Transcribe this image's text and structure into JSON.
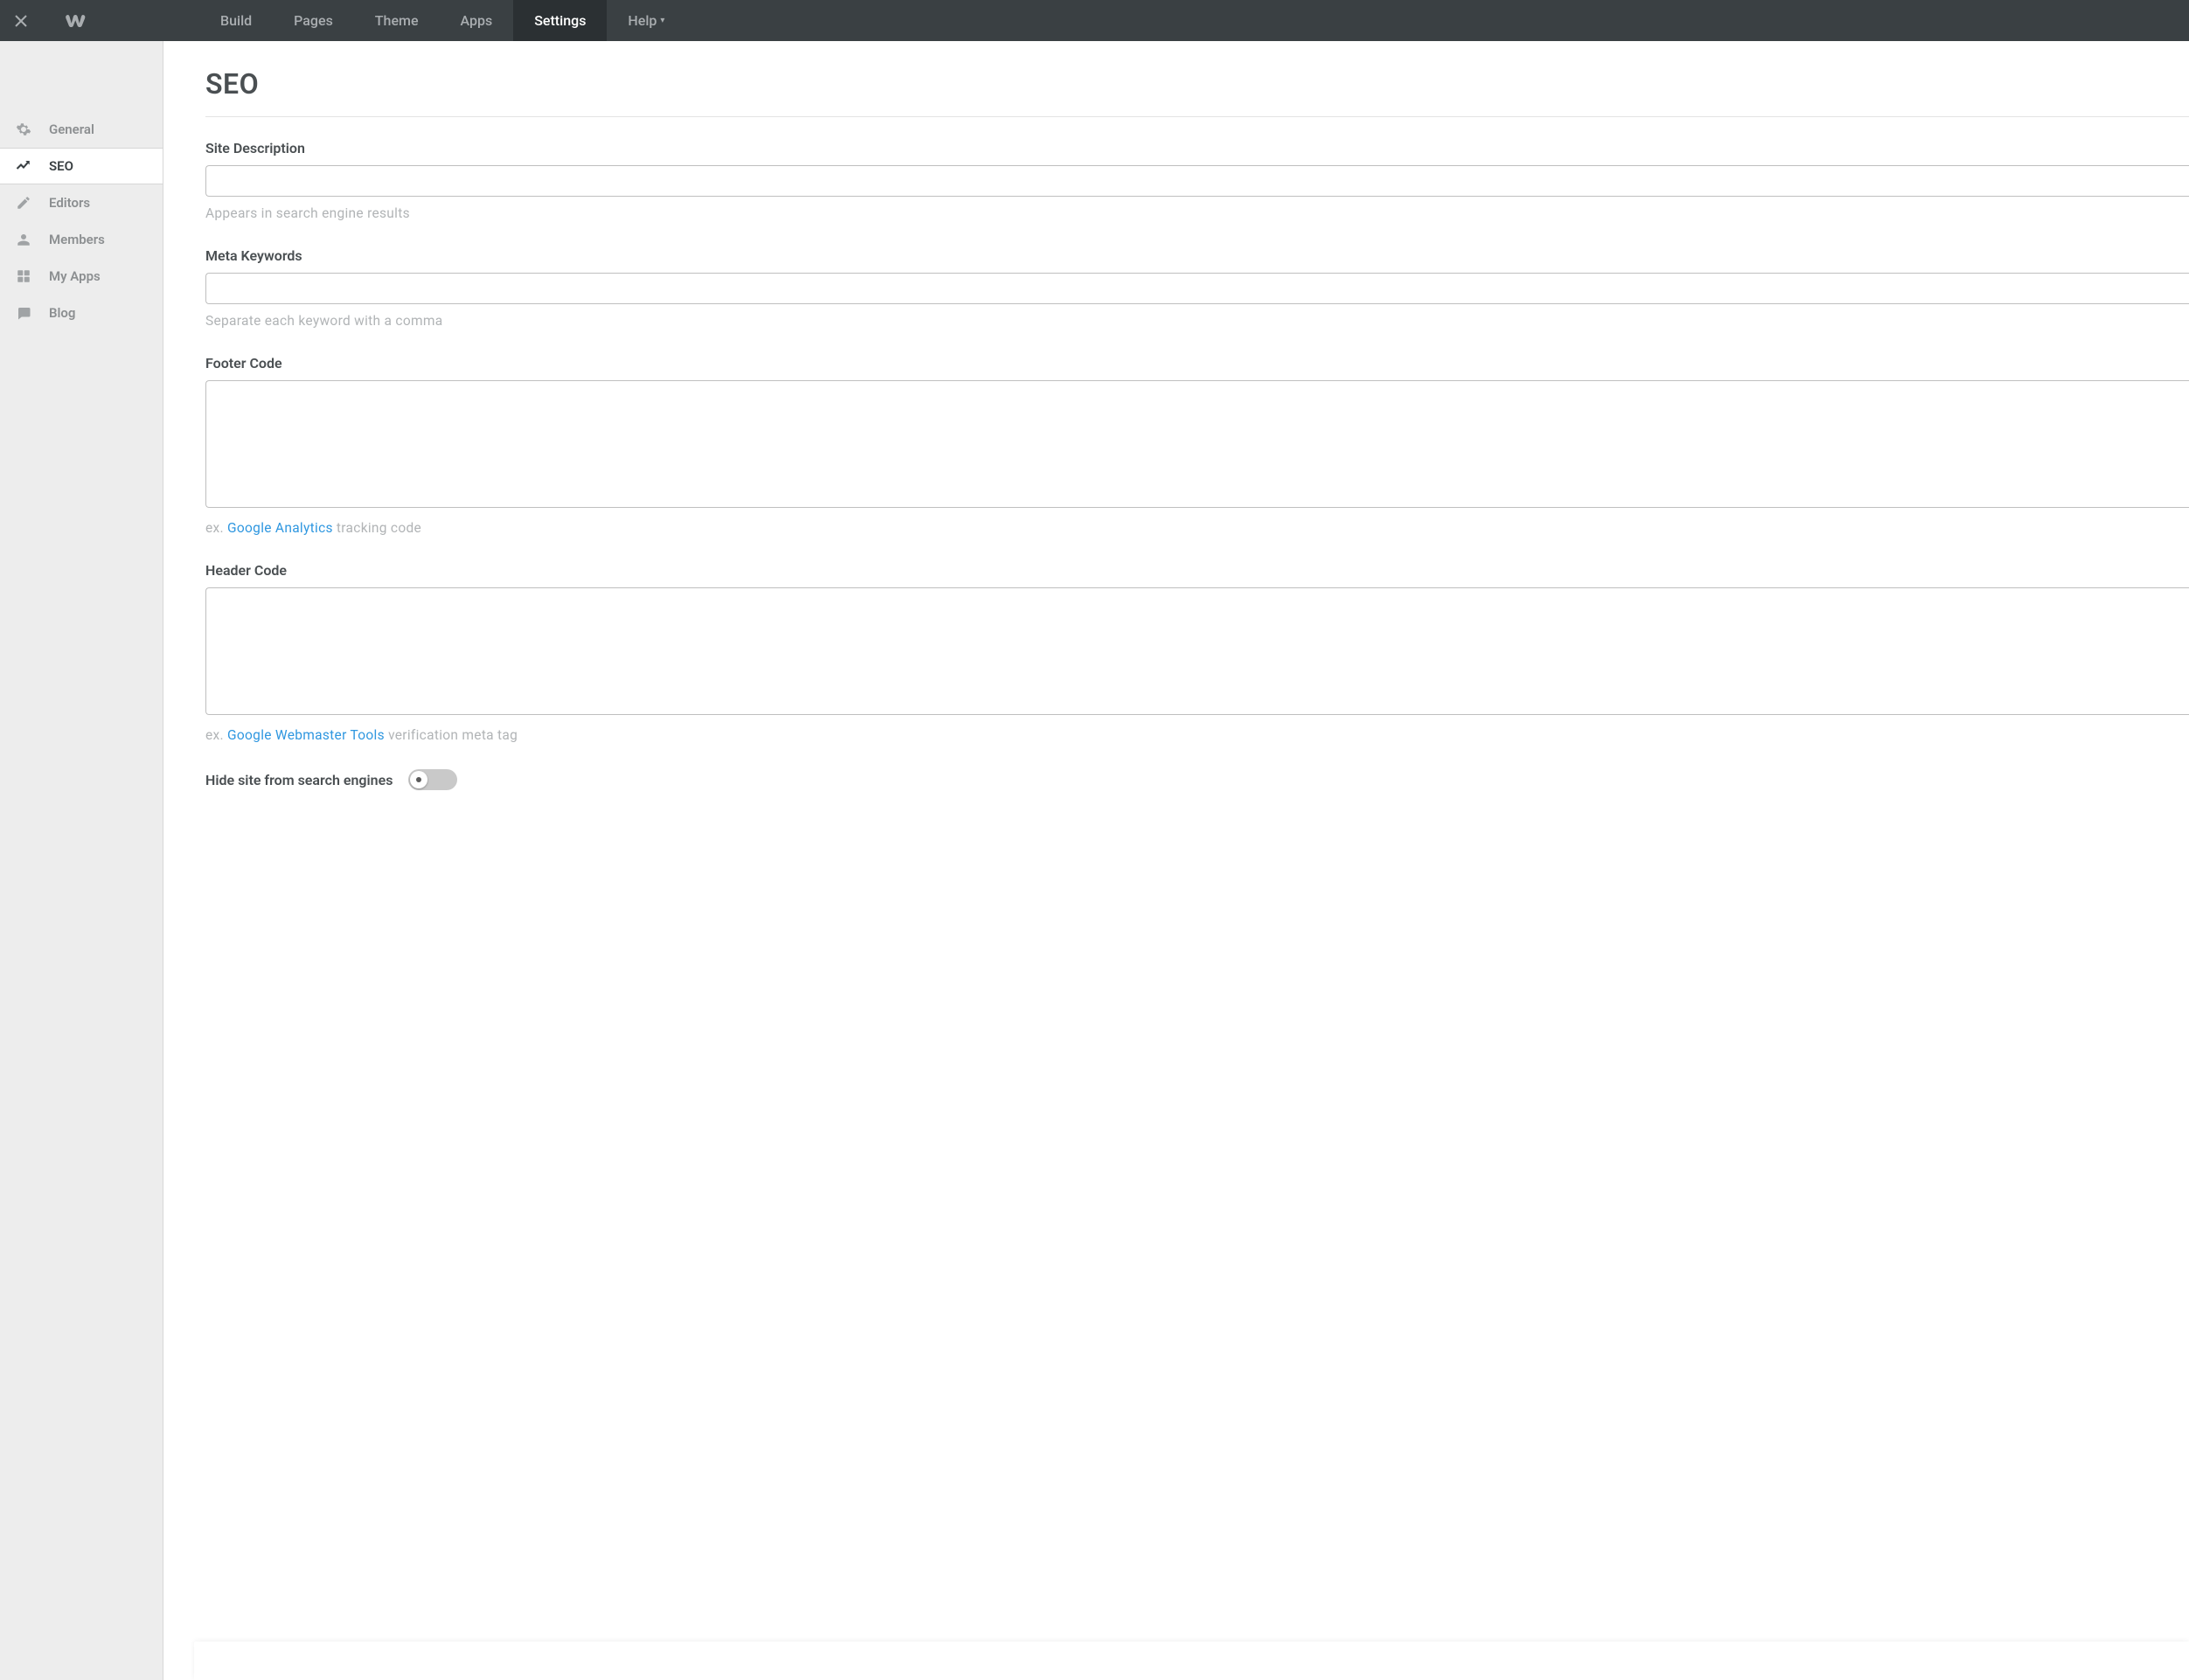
{
  "topnav": {
    "items": [
      {
        "label": "Build"
      },
      {
        "label": "Pages"
      },
      {
        "label": "Theme"
      },
      {
        "label": "Apps"
      },
      {
        "label": "Settings",
        "active": true
      },
      {
        "label": "Help",
        "dropdown": true
      }
    ]
  },
  "sidebar": {
    "items": [
      {
        "label": "General"
      },
      {
        "label": "SEO",
        "active": true
      },
      {
        "label": "Editors"
      },
      {
        "label": "Members"
      },
      {
        "label": "My Apps"
      },
      {
        "label": "Blog"
      }
    ]
  },
  "page": {
    "title": "SEO",
    "site_description": {
      "label": "Site Description",
      "value": "",
      "hint": "Appears in search engine results"
    },
    "meta_keywords": {
      "label": "Meta Keywords",
      "value": "",
      "hint": "Separate each keyword with a comma"
    },
    "footer_code": {
      "label": "Footer Code",
      "value": "",
      "hint_prefix": "ex. ",
      "hint_link": "Google Analytics",
      "hint_suffix": " tracking code"
    },
    "header_code": {
      "label": "Header Code",
      "value": "",
      "hint_prefix": "ex. ",
      "hint_link": "Google Webmaster Tools",
      "hint_suffix": " verification meta tag"
    },
    "hide_site": {
      "label": "Hide site from search engines",
      "value": false
    }
  }
}
